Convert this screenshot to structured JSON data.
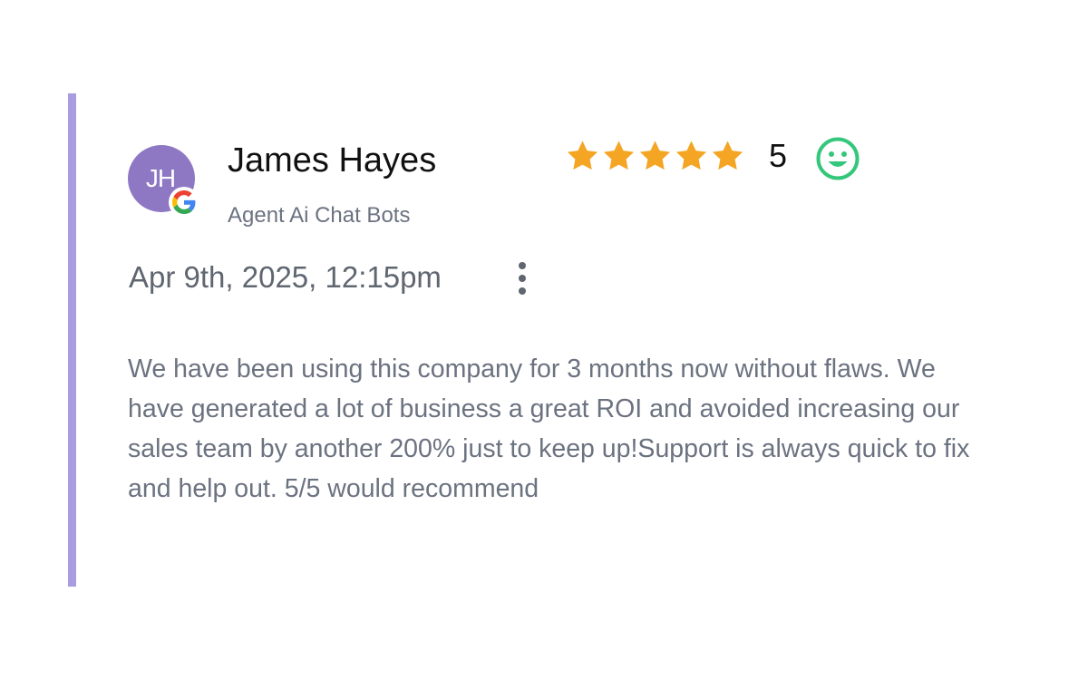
{
  "review": {
    "avatar_initials": "JH",
    "reviewer_name": "James Hayes",
    "company": "Agent Ai Chat Bots",
    "rating": 5,
    "rating_max": 5,
    "rating_label": "5",
    "date": "Apr 9th, 2025, 12:15pm",
    "text": "We have been using this company for 3 months now without flaws. We have generated a lot of business a great ROI and avoided increasing our sales team by another 200% just to keep up!Support is always quick to fix and help out. 5/5 would recommend"
  },
  "icons": {
    "source": "google-icon",
    "star": "star-icon",
    "sentiment": "smiley-face-icon",
    "menu": "more-vertical-icon"
  },
  "colors": {
    "accent_bar": "#a99de0",
    "avatar_bg": "#8e78c4",
    "star": "#f5a524",
    "smiley": "#34c77b",
    "muted_text": "#6b7280"
  }
}
